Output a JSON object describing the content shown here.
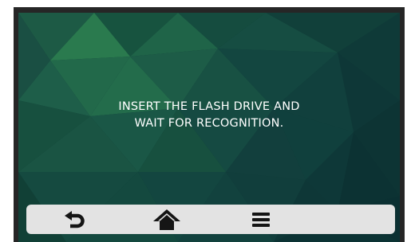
{
  "message": {
    "line1": "INSERT THE FLASH DRIVE AND",
    "line2": "WAIT FOR RECOGNITION."
  },
  "navbar": {
    "buttons": [
      {
        "icon": "back-arrow-icon"
      },
      {
        "icon": "home-icon"
      },
      {
        "icon": "menu-icon"
      }
    ]
  },
  "colors": {
    "bezel": "#262626",
    "background_base": "#123a36",
    "text": "#ffffff",
    "navbar": "#e3e3e3",
    "icon": "#151515"
  }
}
